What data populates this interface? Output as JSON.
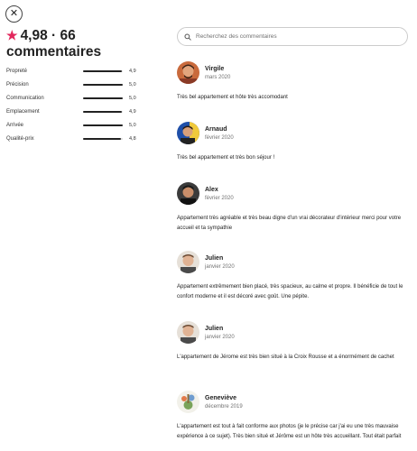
{
  "close": {
    "icon": "close-icon",
    "glyph": "✕"
  },
  "summary": {
    "star_icon": "star-icon",
    "star_color": "#e2275c",
    "rating": "4,98",
    "separator": "·",
    "count": "66",
    "count_label": "commentaires"
  },
  "categories": [
    {
      "label": "Propreté",
      "value": "4,9",
      "score": 4.9
    },
    {
      "label": "Précision",
      "value": "5,0",
      "score": 5.0
    },
    {
      "label": "Communication",
      "value": "5,0",
      "score": 5.0
    },
    {
      "label": "Emplacement",
      "value": "4,9",
      "score": 4.9
    },
    {
      "label": "Arrivée",
      "value": "5,0",
      "score": 5.0
    },
    {
      "label": "Qualité-prix",
      "value": "4,8",
      "score": 4.8
    }
  ],
  "search": {
    "placeholder": "Recherchez des commentaires",
    "icon": "search-icon"
  },
  "reviews": [
    {
      "name": "Virgile",
      "date": "mars 2020",
      "text": "Très bel appartement et hôte très accomodant"
    },
    {
      "name": "Arnaud",
      "date": "février 2020",
      "text": "Très bel appartement et très bon séjour !"
    },
    {
      "name": "Alex",
      "date": "février 2020",
      "text": "Appartement très agréable et très beau digne d'un vrai décorateur d'intérieur merci pour votre accueil et ta sympathie"
    },
    {
      "name": "Julien",
      "date": "janvier 2020",
      "text": "Appartement extrêmement bien placé, très spacieux, au calme et propre. Il bénéficie de tout le confort moderne et il est décoré avec goût. Une pépite."
    },
    {
      "name": "Julien",
      "date": "janvier 2020",
      "text": "L'appartement de Jérome est très bien situé à la Croix Rousse et a énormément de cachet"
    },
    {
      "name": "Geneviève",
      "date": "décembre 2019",
      "text": "L'appartement est tout à fait conforme aux photos (je le précise car j'ai eu une très mauvaise expérience à ce sujet). Très bien situé et Jérôme est un hôte très accueillant. Tout était parfait"
    }
  ]
}
